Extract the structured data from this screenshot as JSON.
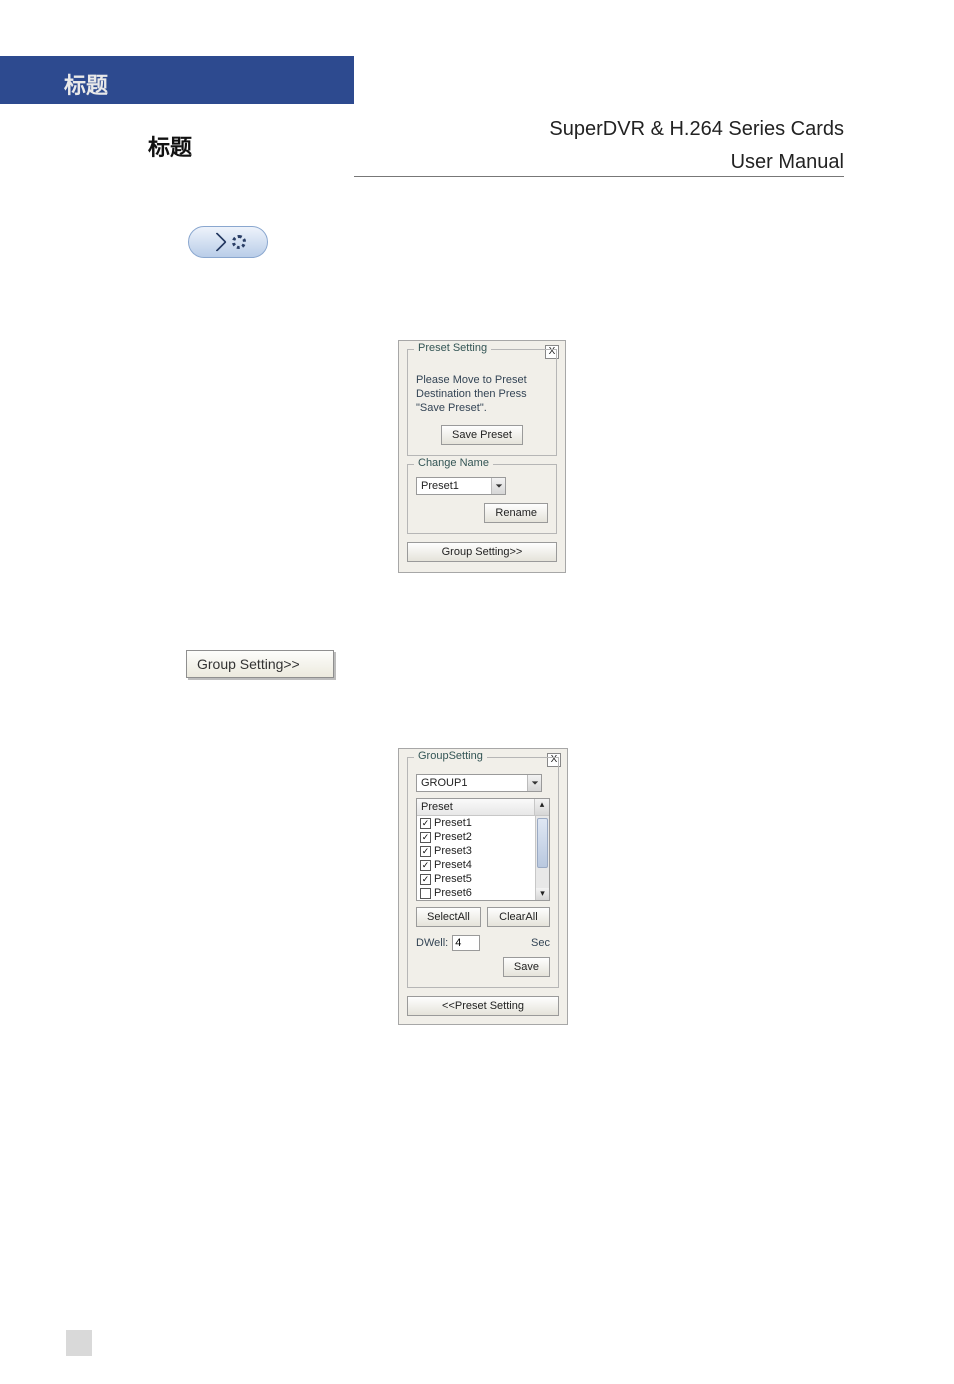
{
  "header": {
    "title1": "标题",
    "title2": "标题",
    "product_line": "SuperDVR & H.264 Series Cards",
    "doc_type": "User  Manual"
  },
  "toolbar_icon": {
    "name": "ptz-tool-icon"
  },
  "preset_dialog": {
    "group_label": "Preset Setting",
    "close": "X",
    "message": "Please Move to Preset Destination then Press \"Save Preset\".",
    "save_label": "Save Preset",
    "change_group_label": "Change Name",
    "selected_preset": "Preset1",
    "rename_label": "Rename",
    "group_setting_label": "Group Setting>>"
  },
  "group_setting_button": {
    "label": "Group Setting>>"
  },
  "group_dialog": {
    "group_label": "GroupSetting",
    "close": "X",
    "selected_group": "GROUP1",
    "list_header": "Preset",
    "items": [
      {
        "label": "Preset1",
        "checked": true
      },
      {
        "label": "Preset2",
        "checked": true
      },
      {
        "label": "Preset3",
        "checked": true
      },
      {
        "label": "Preset4",
        "checked": true
      },
      {
        "label": "Preset5",
        "checked": true
      },
      {
        "label": "Preset6",
        "checked": false
      }
    ],
    "select_all_label": "SelectAll",
    "clear_all_label": "ClearAll",
    "dwell_label": "DWell:",
    "dwell_value": "4",
    "dwell_unit": "Sec",
    "save_label": "Save",
    "back_label": "<<Preset Setting"
  }
}
